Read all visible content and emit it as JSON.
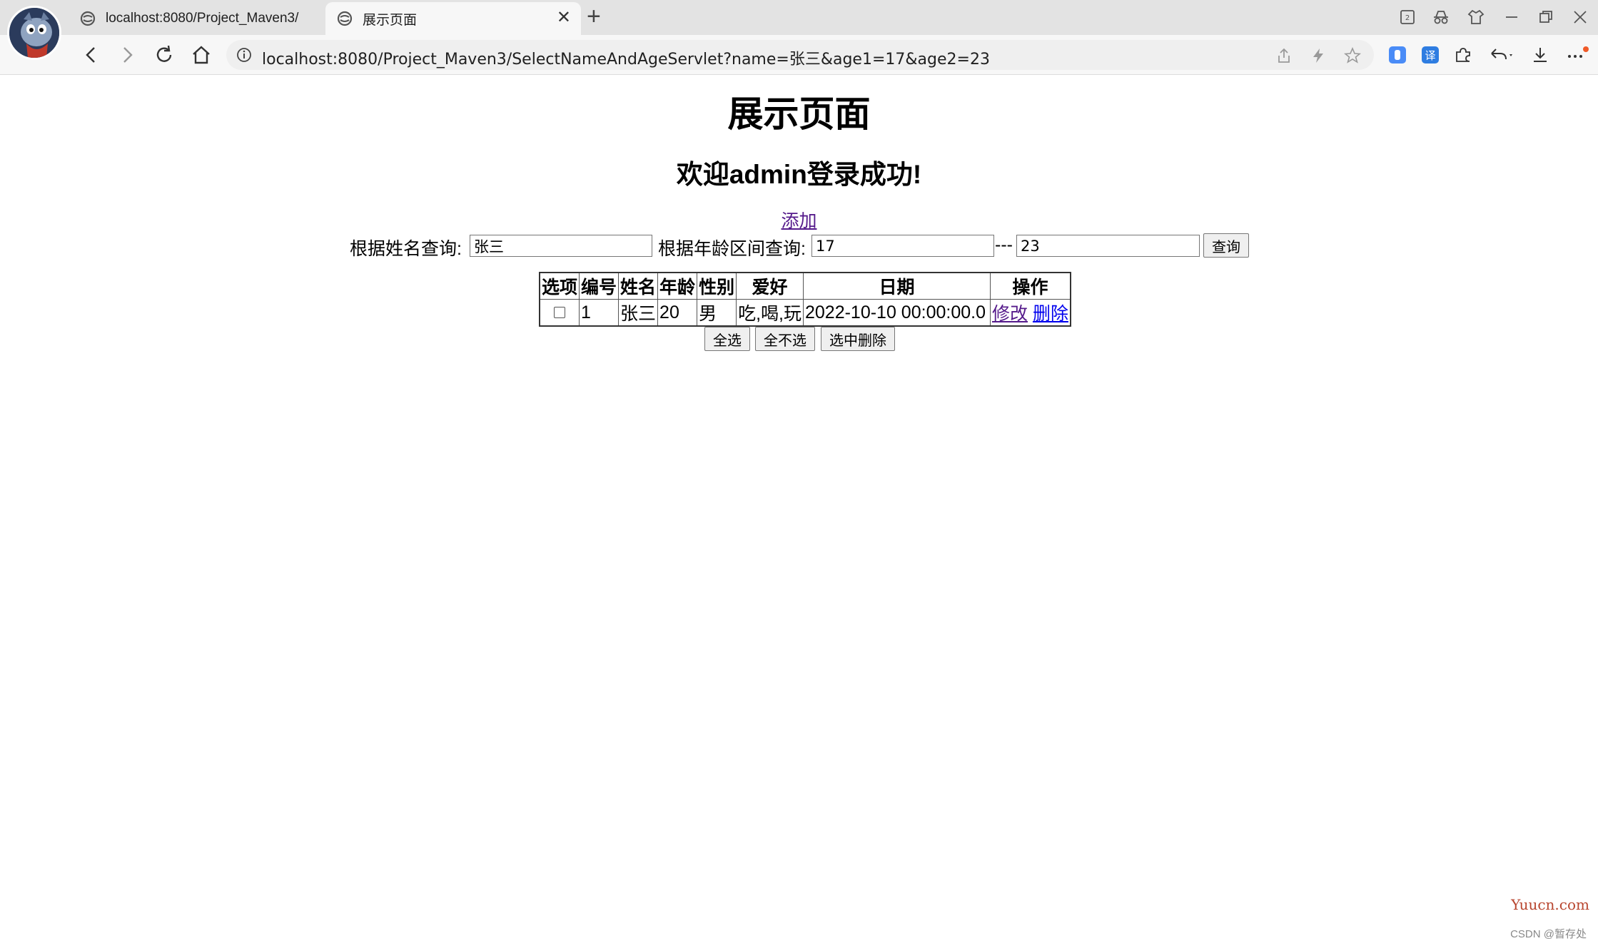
{
  "browser": {
    "tabs": [
      {
        "title": "localhost:8080/Project_Maven3/"
      },
      {
        "title": "展示页面"
      }
    ],
    "url": "localhost:8080/Project_Maven3/SelectNameAndAgeServlet?name=张三&age1=17&age2=23",
    "tab_counter": "2"
  },
  "page": {
    "title": "展示页面",
    "welcome": "欢迎admin登录成功!",
    "add_link": "添加",
    "search": {
      "name_label": "根据姓名查询:",
      "name_value": "张三",
      "age_label": "根据年龄区间查询:",
      "age_from": "17",
      "separator": "---",
      "age_to": "23",
      "query_button": "查询"
    },
    "table": {
      "headers": [
        "选项",
        "编号",
        "姓名",
        "年龄",
        "性别",
        "爱好",
        "日期",
        "操作"
      ],
      "rows": [
        {
          "id": "1",
          "name": "张三",
          "age": "20",
          "gender": "男",
          "hobby": "吃,喝,玩",
          "date": "2022-10-10 00:00:00.0",
          "edit": "修改",
          "delete": "删除"
        }
      ]
    },
    "actions": {
      "select_all": "全选",
      "select_none": "全不选",
      "delete_selected": "选中删除"
    }
  },
  "watermark": {
    "site": "Yuucn.com",
    "csdn": "CSDN @暂存处"
  }
}
